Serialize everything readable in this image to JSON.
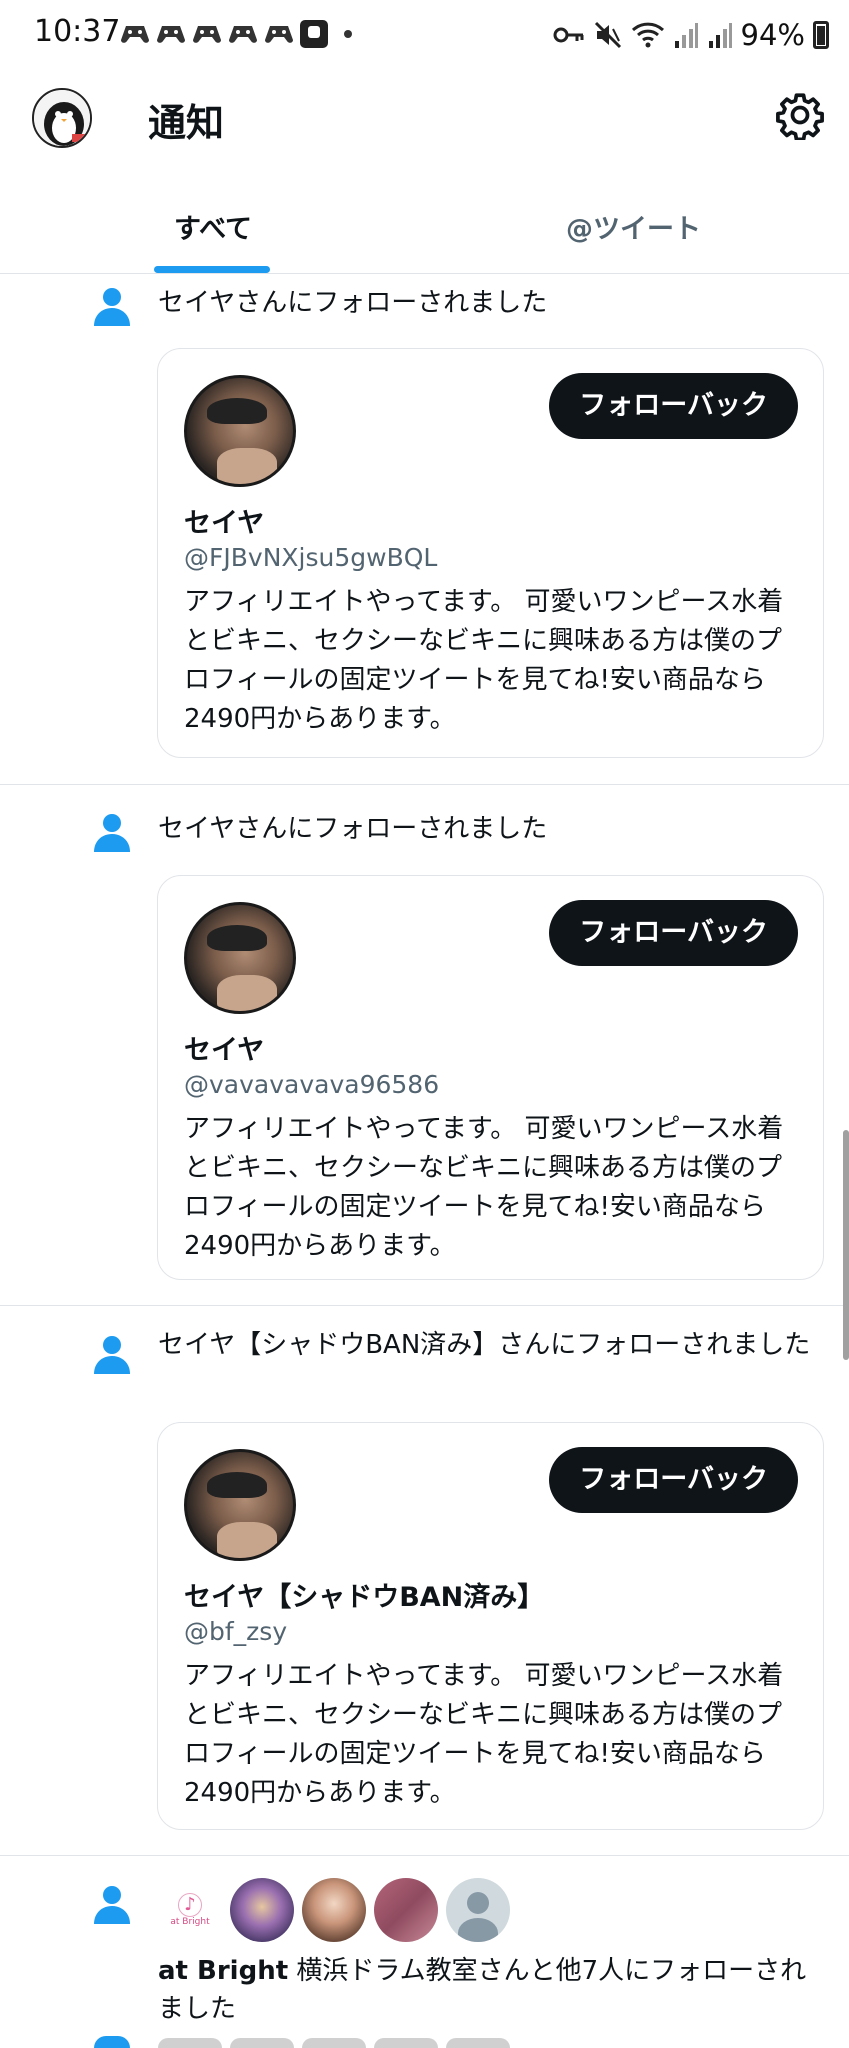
{
  "status_bar": {
    "time": "10:37",
    "battery": "94%"
  },
  "header": {
    "title": "通知",
    "settings_icon": "gear-icon"
  },
  "tabs": [
    {
      "label": "すべて",
      "selected": true
    },
    {
      "label": "@ツイート",
      "selected": false
    }
  ],
  "colors": {
    "accent": "#1d9bf0",
    "button_bg": "#0f1419",
    "secondary_text": "#536471"
  },
  "notifications": [
    {
      "text": "セイヤさんにフォローされました",
      "card": {
        "name": "セイヤ",
        "handle": "@FJBvNXjsu5gwBQL",
        "bio": "アフィリエイトやってます。 可愛いワンピース水着とビキニ、セクシーなビキニに興味ある方は僕のプロフィールの固定ツイートを見てね!安い商品なら2490円からあります。",
        "button": "フォローバック"
      }
    },
    {
      "text": "セイヤさんにフォローされました",
      "card": {
        "name": "セイヤ",
        "handle": "@vavavavava96586",
        "bio": "アフィリエイトやってます。 可愛いワンピース水着とビキニ、セクシーなビキニに興味ある方は僕のプロフィールの固定ツイートを見てね!安い商品なら2490円からあります。",
        "button": "フォローバック"
      }
    },
    {
      "text": "セイヤ【シャドウBAN済み】さんにフォローされました",
      "card": {
        "name": "セイヤ【シャドウBAN済み】",
        "handle": "@bf_zsy",
        "bio": "アフィリエイトやってます。 可愛いワンピース水着とビキニ、セクシーなビキニに興味ある方は僕のプロフィールの固定ツイートを見てね!安い商品なら2490円からあります。",
        "button": "フォローバック"
      }
    }
  ],
  "group_notification": {
    "avatar_logo_text": "at Bright",
    "bold_name": "at Bright",
    "text_rest": " 横浜ドラム教室さんと他7人にフォローされました"
  }
}
